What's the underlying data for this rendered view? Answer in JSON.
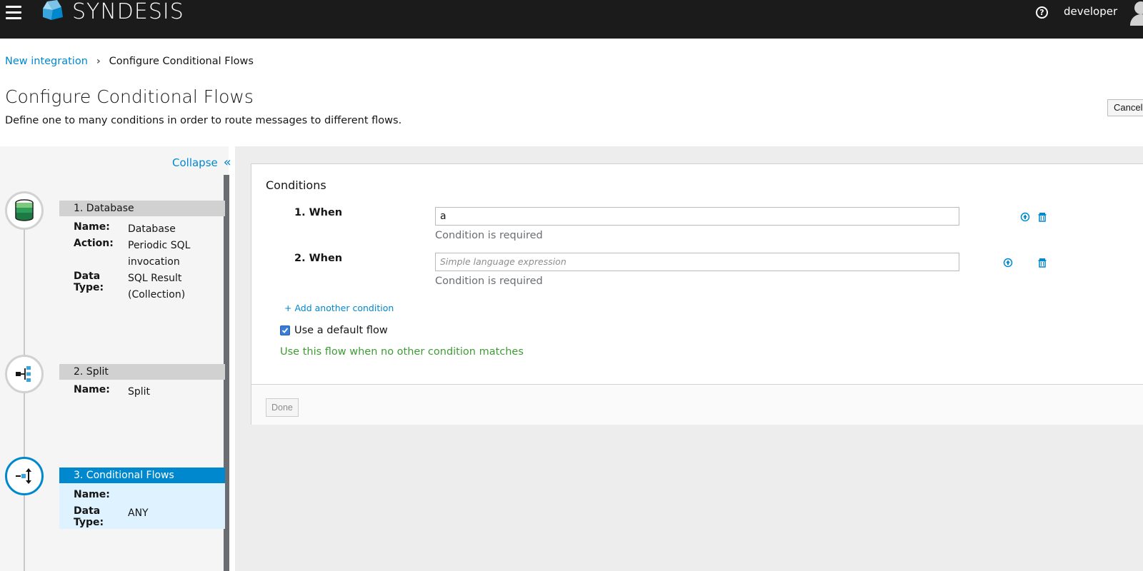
{
  "navbar": {
    "brand": "SYNDESIS",
    "username": "developer"
  },
  "breadcrumb": {
    "parent": "New integration",
    "current": "Configure Conditional Flows"
  },
  "header": {
    "title": "Configure Conditional Flows",
    "description": "Define one to many conditions in order to route messages to different flows.",
    "cancel_label": "Cancel"
  },
  "sidebar": {
    "collapse_label": "Collapse",
    "steps": [
      {
        "title": "1. Database",
        "fields": [
          {
            "key": "Name:",
            "value": "Database"
          },
          {
            "key": "Action:",
            "value": "Periodic SQL invocation"
          },
          {
            "key": "Data Type:",
            "value": "SQL Result (Collection)"
          }
        ]
      },
      {
        "title": "2. Split",
        "fields": [
          {
            "key": "Name:",
            "value": "Split"
          }
        ]
      },
      {
        "title": "3. Conditional Flows",
        "fields": [
          {
            "key": "Name:",
            "value": ""
          },
          {
            "key": "Data Type:",
            "value": "ANY"
          }
        ]
      }
    ]
  },
  "conditions": {
    "title": "Conditions",
    "items": [
      {
        "label": "1. When",
        "value": "a",
        "placeholder": "Simple language expression",
        "error": "Condition is required"
      },
      {
        "label": "2. When",
        "value": "",
        "placeholder": "Simple language expression",
        "error": "Condition is required"
      }
    ],
    "add_label": "+ Add another condition",
    "default_flow_label": "Use a default flow",
    "default_flow_checked": true,
    "default_flow_hint": "Use this flow when no other condition matches",
    "done_label": "Done"
  },
  "colors": {
    "navbar": "#1b1b1b",
    "link": "#0088ce",
    "active_step": "#0088ce",
    "success_text": "#3f9c35"
  }
}
